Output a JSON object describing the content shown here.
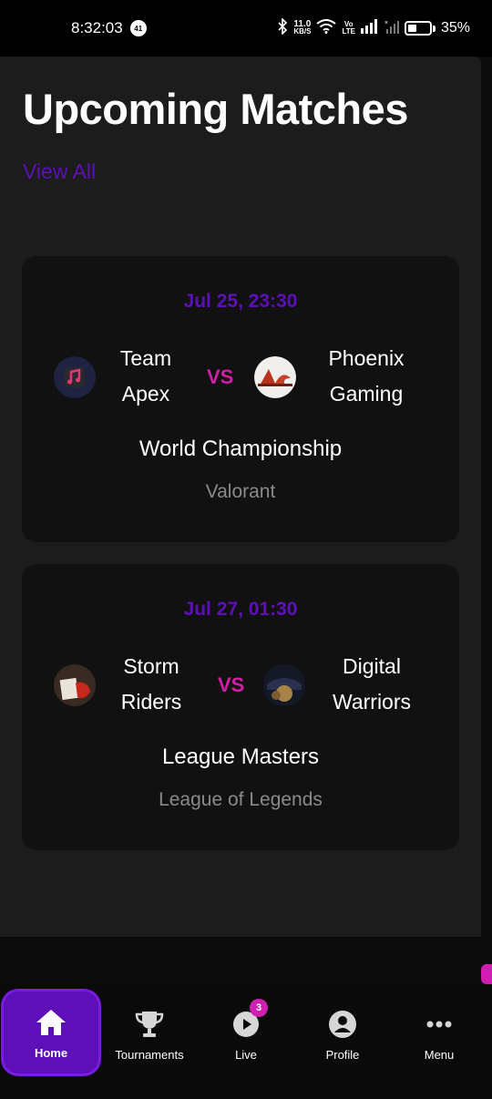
{
  "status_bar": {
    "time": "8:32:03",
    "notification_count": "41",
    "network_speed_value": "11.0",
    "network_speed_unit": "KB/S",
    "volte_top": "Vo",
    "volte_bottom": "LTE",
    "battery": "35%"
  },
  "header": {
    "title": "Upcoming Matches",
    "view_all": "View All"
  },
  "matches": [
    {
      "time": "Jul 25, 23:30",
      "team1": {
        "line1": "Team",
        "line2": "Apex"
      },
      "team2": {
        "line1": "Phoenix",
        "line2": "Gaming"
      },
      "vs": "VS",
      "tournament": "World Championship",
      "game": "Valorant"
    },
    {
      "time": "Jul 27, 01:30",
      "team1": {
        "line1": "Storm",
        "line2": "Riders"
      },
      "team2": {
        "line1": "Digital",
        "line2": "Warriors"
      },
      "vs": "VS",
      "tournament": "League Masters",
      "game": "League of Legends"
    }
  ],
  "nav": {
    "items": [
      {
        "label": "Home",
        "icon": "home-icon",
        "active": true
      },
      {
        "label": "Tournaments",
        "icon": "trophy-icon"
      },
      {
        "label": "Live",
        "icon": "play-icon",
        "badge": "3"
      },
      {
        "label": "Profile",
        "icon": "user-icon"
      },
      {
        "label": "Menu",
        "icon": "more-icon"
      }
    ]
  },
  "colors": {
    "accent_purple": "#5d10b8",
    "accent_pink": "#d01fa6",
    "background": "#1c1c1c",
    "card": "#111111"
  }
}
